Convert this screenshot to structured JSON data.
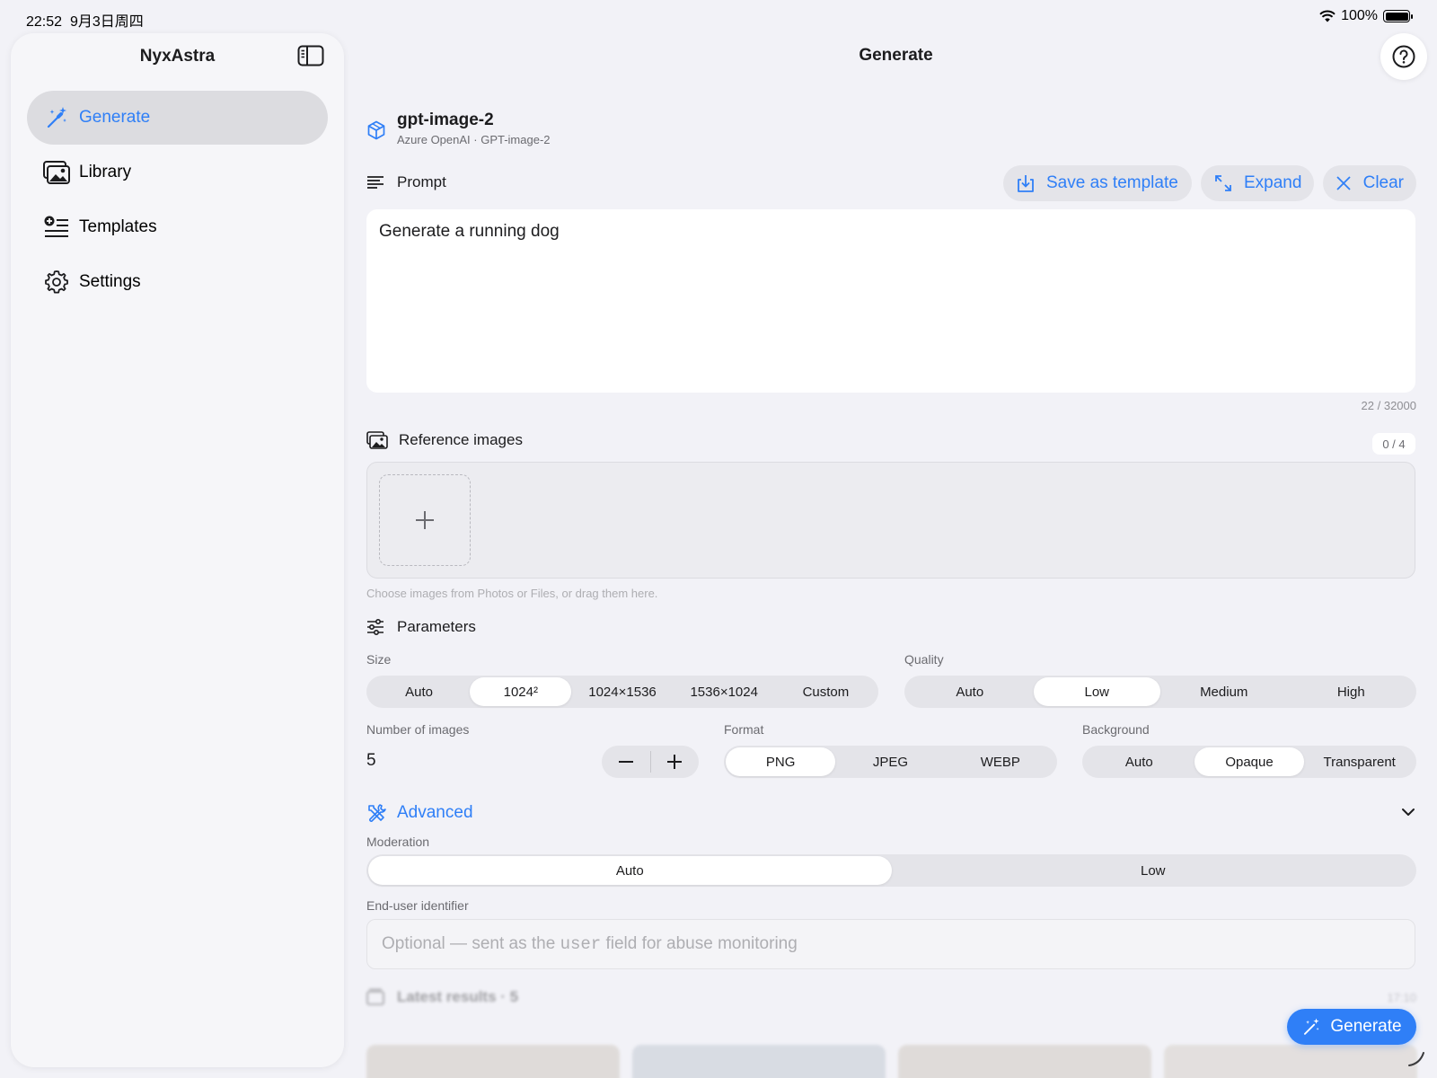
{
  "status_bar": {
    "time": "22:52",
    "date": "9月3日周四",
    "battery": "100%",
    "battery_level": 1.0
  },
  "sidebar": {
    "title": "NyxAstra",
    "items": [
      {
        "label": "Generate",
        "icon": "magic-wand-icon",
        "active": true
      },
      {
        "label": "Library",
        "icon": "photo-library-icon",
        "active": false
      },
      {
        "label": "Templates",
        "icon": "templates-icon",
        "active": false
      },
      {
        "label": "Settings",
        "icon": "gear-icon",
        "active": false
      }
    ]
  },
  "main": {
    "title": "Generate",
    "model": {
      "name": "gpt-image-2",
      "provider": "Azure OpenAI · GPT-image-2"
    },
    "prompt": {
      "header": "Prompt",
      "save_template_label": "Save as template",
      "expand_label": "Expand",
      "clear_label": "Clear",
      "value": "Generate a running dog",
      "char_count": "22 / 32000"
    },
    "reference_images": {
      "header": "Reference images",
      "count": "0 / 4",
      "hint": "Choose images from Photos or Files, or drag them here."
    },
    "parameters": {
      "header": "Parameters",
      "size": {
        "label": "Size",
        "options": [
          "Auto",
          "1024²",
          "1024×1536",
          "1536×1024",
          "Custom"
        ],
        "selected": "1024²"
      },
      "quality": {
        "label": "Quality",
        "options": [
          "Auto",
          "Low",
          "Medium",
          "High"
        ],
        "selected": "Low"
      },
      "number_of_images": {
        "label": "Number of images",
        "value": "5"
      },
      "format": {
        "label": "Format",
        "options": [
          "PNG",
          "JPEG",
          "WEBP"
        ],
        "selected": "PNG"
      },
      "background": {
        "label": "Background",
        "options": [
          "Auto",
          "Opaque",
          "Transparent"
        ],
        "selected": "Opaque"
      }
    },
    "advanced": {
      "header": "Advanced",
      "moderation": {
        "label": "Moderation",
        "options": [
          "Auto",
          "Low"
        ],
        "selected": "Auto"
      },
      "end_user": {
        "label": "End-user identifier",
        "placeholder_pre": "Optional — sent as the ",
        "placeholder_code": "user",
        "placeholder_post": " field for abuse monitoring"
      }
    },
    "latest_results": {
      "header": "Latest results · 5",
      "time": "17:10"
    },
    "generate_button_label": "Generate"
  },
  "colors": {
    "accent": "#2f7ff7",
    "background": "#f2f2f7",
    "segment_bg": "#e4e4e9"
  }
}
